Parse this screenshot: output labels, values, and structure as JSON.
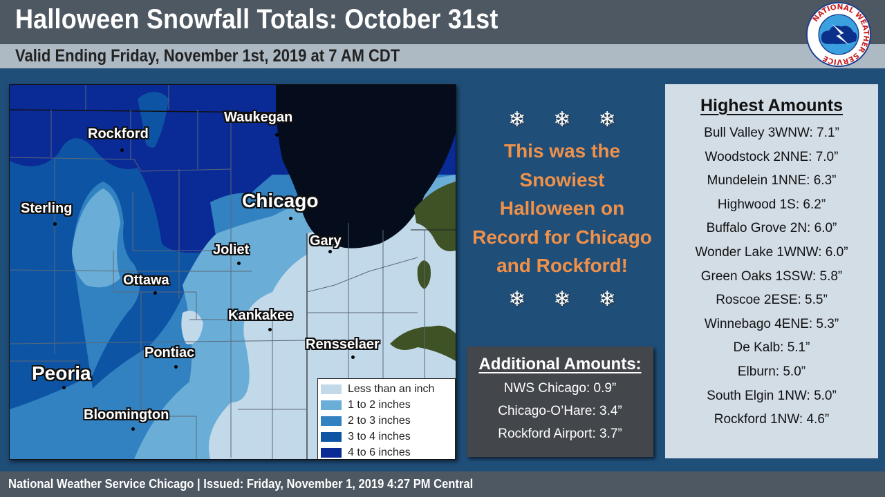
{
  "header": {
    "title": "Halloween Snowfall Totals: October 31st",
    "subtitle": "Valid Ending Friday, November 1st, 2019 at 7 AM CDT",
    "logo": {
      "icon": "nws-logo-icon",
      "ring_text": "NATIONAL WEATHER SERVICE"
    }
  },
  "map": {
    "cities": [
      {
        "name": "Waukegan",
        "size": "small"
      },
      {
        "name": "Rockford",
        "size": "small"
      },
      {
        "name": "Chicago",
        "size": "large"
      },
      {
        "name": "Sterling",
        "size": "small"
      },
      {
        "name": "Gary",
        "size": "small"
      },
      {
        "name": "Joliet",
        "size": "small"
      },
      {
        "name": "Ottawa",
        "size": "small"
      },
      {
        "name": "Kankakee",
        "size": "small"
      },
      {
        "name": "Rensselaer",
        "size": "small"
      },
      {
        "name": "Pontiac",
        "size": "small"
      },
      {
        "name": "Peoria",
        "size": "large"
      },
      {
        "name": "Bloomington",
        "size": "small"
      }
    ],
    "legend": [
      {
        "label": "Less than an inch",
        "color": "#c2d9ea"
      },
      {
        "label": "1 to 2 inches",
        "color": "#6aaed8"
      },
      {
        "label": "2 to 3 inches",
        "color": "#3282c2"
      },
      {
        "label": "3 to 4 inches",
        "color": "#0d55a4"
      },
      {
        "label": "4 to 6 inches",
        "color": "#0a2a96"
      }
    ],
    "lake_color": "#050c1c",
    "land_color": "#3e5226"
  },
  "record": {
    "snowflake_icon": "❄",
    "lines": [
      "This was the",
      "Snowiest",
      "Halloween on",
      "Record for Chicago",
      "and Rockford!"
    ]
  },
  "additional": {
    "title": "Additional Amounts:",
    "items": [
      "NWS Chicago: 0.9”",
      "Chicago-O’Hare: 3.4”",
      "Rockford Airport: 3.7”"
    ]
  },
  "highest": {
    "title": "Highest Amounts",
    "items": [
      "Bull Valley 3WNW: 7.1”",
      "Woodstock 2NNE: 7.0”",
      "Mundelein 1NNE: 6.3”",
      "Highwood 1S: 6.2”",
      "Buffalo Grove 2N: 6.0”",
      "Wonder Lake 1WNW: 6.0”",
      "Green Oaks 1SSW: 5.8”",
      "Roscoe 2ESE: 5.5”",
      "Winnebago 4ENE: 5.3”",
      "De Kalb: 5.1”",
      "Elburn: 5.0”",
      "South Elgin 1NW: 5.0”",
      "Rockford 1NW: 4.6”"
    ]
  },
  "footer": {
    "text": "National Weather Service Chicago | Issued: Friday, November 1, 2019 4:27 PM Central"
  },
  "colors": {
    "title_bar": "#4d5862",
    "subtitle_bar": "#adb9c3",
    "background": "#1f4e79",
    "accent_orange": "#f0914a"
  }
}
